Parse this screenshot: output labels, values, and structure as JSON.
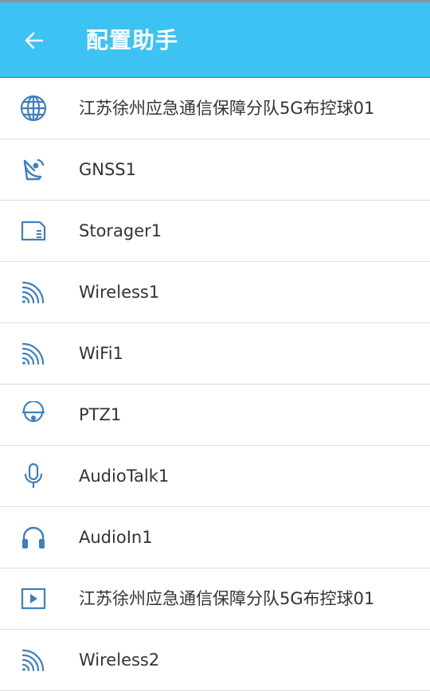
{
  "app": {
    "title": "配置助手"
  },
  "colors": {
    "header_bg": "#3cc3f3",
    "icon": "#3e7fbf",
    "text": "#333333"
  },
  "list": {
    "items": [
      {
        "label": "江苏徐州应急通信保障分队5G布控球01",
        "icon": "globe-icon"
      },
      {
        "label": "GNSS1",
        "icon": "satellite-dish-icon"
      },
      {
        "label": "Storager1",
        "icon": "sd-card-icon"
      },
      {
        "label": "Wireless1",
        "icon": "signal-wave-icon"
      },
      {
        "label": "WiFi1",
        "icon": "signal-wave-icon"
      },
      {
        "label": "PTZ1",
        "icon": "dome-camera-icon"
      },
      {
        "label": "AudioTalk1",
        "icon": "microphone-icon"
      },
      {
        "label": "AudioIn1",
        "icon": "headphones-icon"
      },
      {
        "label": "江苏徐州应急通信保障分队5G布控球01",
        "icon": "video-play-icon"
      },
      {
        "label": "Wireless2",
        "icon": "signal-wave-icon"
      }
    ]
  }
}
